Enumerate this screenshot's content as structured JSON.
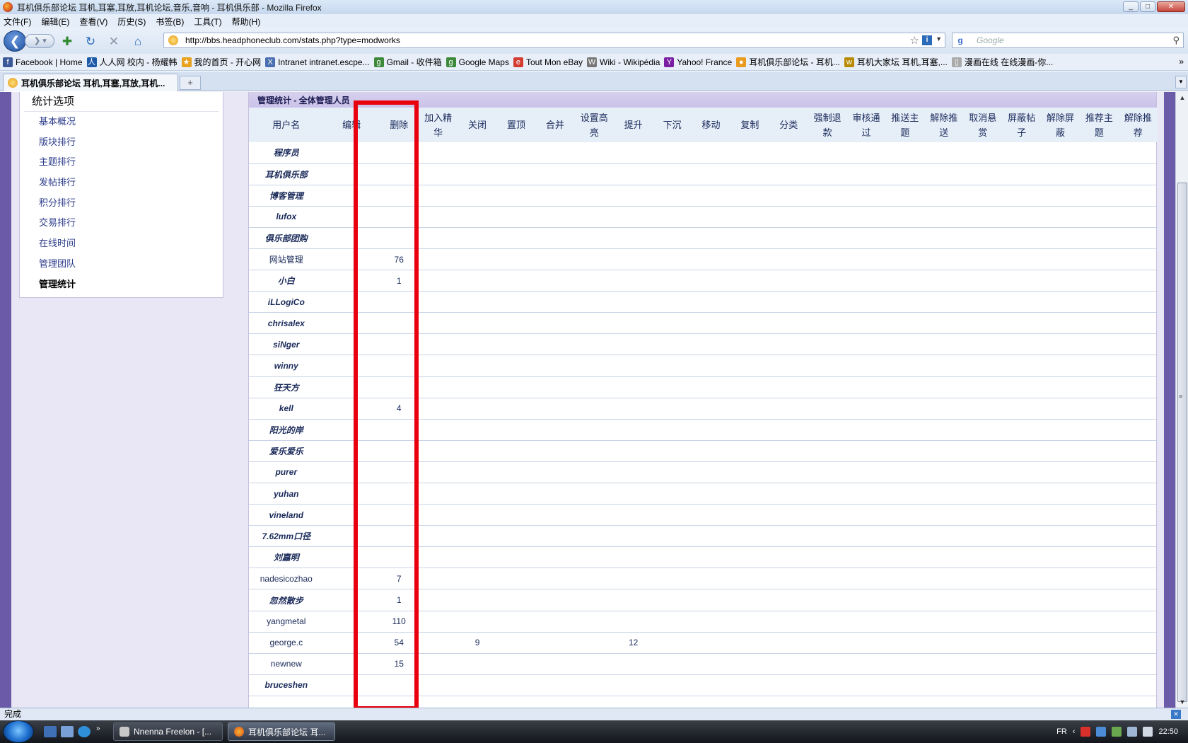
{
  "window": {
    "title": "耳机俱乐部论坛 耳机,耳塞,耳放,耳机论坛,音乐,音响 - 耳机俱乐部 - Mozilla Firefox",
    "buttons": [
      "_",
      "□",
      "✕"
    ]
  },
  "menu": [
    "文件(F)",
    "编辑(E)",
    "查看(V)",
    "历史(S)",
    "书签(B)",
    "工具(T)",
    "帮助(H)"
  ],
  "toolbar": {
    "url": "http://bbs.headphoneclub.com/stats.php?type=modworks",
    "search_placeholder": "Google"
  },
  "bookmarks": [
    {
      "label": "Facebook | Home",
      "icon": "facebook-icon",
      "color": "#3b5998",
      "glyph": "f"
    },
    {
      "label": "人人网 校内 - 杨耀韩",
      "icon": "renren-icon",
      "color": "#1e5aa8",
      "glyph": "人"
    },
    {
      "label": "我的首页 - 开心网",
      "icon": "kaixin-icon",
      "color": "#e8a21e",
      "glyph": "★"
    },
    {
      "label": "Intranet intranet.escpe...",
      "icon": "intranet-icon",
      "color": "#4a6fb0",
      "glyph": "X"
    },
    {
      "label": "Gmail - 收件箱",
      "icon": "google-icon",
      "color": "#3c8a3a",
      "glyph": "g"
    },
    {
      "label": "Google Maps",
      "icon": "google-icon",
      "color": "#3c8a3a",
      "glyph": "g"
    },
    {
      "label": "Tout Mon eBay",
      "icon": "ebay-icon",
      "color": "#d33c2f",
      "glyph": "e"
    },
    {
      "label": "Wiki - Wikipédia",
      "icon": "wikipedia-icon",
      "color": "#777777",
      "glyph": "W"
    },
    {
      "label": "Yahoo! France",
      "icon": "yahoo-icon",
      "color": "#7b1fa2",
      "glyph": "Y"
    },
    {
      "label": "耳机俱乐部论坛 - 耳机...",
      "icon": "headphoneclub-icon",
      "color": "#e89b1c",
      "glyph": "●"
    },
    {
      "label": "耳机大家坛 耳机,耳塞,...",
      "icon": "forum-icon",
      "color": "#b88a00",
      "glyph": "w"
    },
    {
      "label": "漫画在线 在线漫画-你...",
      "icon": "page-icon",
      "color": "#aaaaaa",
      "glyph": "▯"
    }
  ],
  "tab": {
    "label": "耳机俱乐部论坛 耳机,耳塞,耳放,耳机..."
  },
  "sidebar": {
    "title": "统计选项",
    "items": [
      "基本概况",
      "版块排行",
      "主题排行",
      "发帖排行",
      "积分排行",
      "交易排行",
      "在线时间",
      "管理团队",
      "管理统计"
    ],
    "active": "管理统计"
  },
  "panel": {
    "title": "管理统计 - 全体管理人员",
    "columns": [
      "用户名",
      "编辑",
      "删除",
      "加入精华",
      "关闭",
      "置顶",
      "合并",
      "设置高亮",
      "提升",
      "下沉",
      "移动",
      "复制",
      "分类",
      "强制退款",
      "审核通过",
      "推送主题",
      "解除推送",
      "取消悬赏",
      "屏蔽帖子",
      "解除屏蔽",
      "推荐主题",
      "解除推荐"
    ],
    "rows": [
      {
        "name": "程序员",
        "bold": true,
        "values": [
          "",
          "",
          "",
          "",
          "",
          "",
          "",
          "",
          "",
          "",
          "",
          "",
          "",
          "",
          "",
          "",
          "",
          "",
          "",
          "",
          ""
        ]
      },
      {
        "name": "耳机俱乐部",
        "bold": true,
        "values": [
          "",
          "",
          "",
          "",
          "",
          "",
          "",
          "",
          "",
          "",
          "",
          "",
          "",
          "",
          "",
          "",
          "",
          "",
          "",
          "",
          ""
        ]
      },
      {
        "name": "博客管理",
        "bold": true,
        "values": [
          "",
          "",
          "",
          "",
          "",
          "",
          "",
          "",
          "",
          "",
          "",
          "",
          "",
          "",
          "",
          "",
          "",
          "",
          "",
          "",
          ""
        ]
      },
      {
        "name": "lufox",
        "bold": true,
        "values": [
          "",
          "",
          "",
          "",
          "",
          "",
          "",
          "",
          "",
          "",
          "",
          "",
          "",
          "",
          "",
          "",
          "",
          "",
          "",
          "",
          ""
        ]
      },
      {
        "name": "俱乐部团购",
        "bold": true,
        "values": [
          "",
          "",
          "",
          "",
          "",
          "",
          "",
          "",
          "",
          "",
          "",
          "",
          "",
          "",
          "",
          "",
          "",
          "",
          "",
          "",
          ""
        ]
      },
      {
        "name": "网站管理",
        "bold": false,
        "values": [
          "",
          "76",
          "",
          "",
          "",
          "",
          "",
          "",
          "",
          "",
          "",
          "",
          "",
          "",
          "",
          "",
          "",
          "",
          "",
          "",
          ""
        ]
      },
      {
        "name": "小白",
        "bold": true,
        "values": [
          "",
          "1",
          "",
          "",
          "",
          "",
          "",
          "",
          "",
          "",
          "",
          "",
          "",
          "",
          "",
          "",
          "",
          "",
          "",
          "",
          ""
        ]
      },
      {
        "name": "iLLogiCo",
        "bold": true,
        "values": [
          "",
          "",
          "",
          "",
          "",
          "",
          "",
          "",
          "",
          "",
          "",
          "",
          "",
          "",
          "",
          "",
          "",
          "",
          "",
          "",
          ""
        ]
      },
      {
        "name": "chrisalex",
        "bold": true,
        "values": [
          "",
          "",
          "",
          "",
          "",
          "",
          "",
          "",
          "",
          "",
          "",
          "",
          "",
          "",
          "",
          "",
          "",
          "",
          "",
          "",
          ""
        ]
      },
      {
        "name": "siNger",
        "bold": true,
        "values": [
          "",
          "",
          "",
          "",
          "",
          "",
          "",
          "",
          "",
          "",
          "",
          "",
          "",
          "",
          "",
          "",
          "",
          "",
          "",
          "",
          ""
        ]
      },
      {
        "name": "winny",
        "bold": true,
        "values": [
          "",
          "",
          "",
          "",
          "",
          "",
          "",
          "",
          "",
          "",
          "",
          "",
          "",
          "",
          "",
          "",
          "",
          "",
          "",
          "",
          ""
        ]
      },
      {
        "name": "狂天方",
        "bold": true,
        "values": [
          "",
          "",
          "",
          "",
          "",
          "",
          "",
          "",
          "",
          "",
          "",
          "",
          "",
          "",
          "",
          "",
          "",
          "",
          "",
          "",
          ""
        ]
      },
      {
        "name": "kell",
        "bold": true,
        "values": [
          "",
          "4",
          "",
          "",
          "",
          "",
          "",
          "",
          "",
          "",
          "",
          "",
          "",
          "",
          "",
          "",
          "",
          "",
          "",
          "",
          ""
        ]
      },
      {
        "name": "阳光的岸",
        "bold": true,
        "values": [
          "",
          "",
          "",
          "",
          "",
          "",
          "",
          "",
          "",
          "",
          "",
          "",
          "",
          "",
          "",
          "",
          "",
          "",
          "",
          "",
          ""
        ]
      },
      {
        "name": "爱乐爱乐",
        "bold": true,
        "values": [
          "",
          "",
          "",
          "",
          "",
          "",
          "",
          "",
          "",
          "",
          "",
          "",
          "",
          "",
          "",
          "",
          "",
          "",
          "",
          "",
          ""
        ]
      },
      {
        "name": "purer",
        "bold": true,
        "values": [
          "",
          "",
          "",
          "",
          "",
          "",
          "",
          "",
          "",
          "",
          "",
          "",
          "",
          "",
          "",
          "",
          "",
          "",
          "",
          "",
          ""
        ]
      },
      {
        "name": "yuhan",
        "bold": true,
        "values": [
          "",
          "",
          "",
          "",
          "",
          "",
          "",
          "",
          "",
          "",
          "",
          "",
          "",
          "",
          "",
          "",
          "",
          "",
          "",
          "",
          ""
        ]
      },
      {
        "name": "vineland",
        "bold": true,
        "values": [
          "",
          "",
          "",
          "",
          "",
          "",
          "",
          "",
          "",
          "",
          "",
          "",
          "",
          "",
          "",
          "",
          "",
          "",
          "",
          "",
          ""
        ]
      },
      {
        "name": "7.62mm口径",
        "bold": true,
        "values": [
          "",
          "",
          "",
          "",
          "",
          "",
          "",
          "",
          "",
          "",
          "",
          "",
          "",
          "",
          "",
          "",
          "",
          "",
          "",
          "",
          ""
        ]
      },
      {
        "name": "刘嘉明",
        "bold": true,
        "values": [
          "",
          "",
          "",
          "",
          "",
          "",
          "",
          "",
          "",
          "",
          "",
          "",
          "",
          "",
          "",
          "",
          "",
          "",
          "",
          "",
          ""
        ]
      },
      {
        "name": "nadesicozhao",
        "bold": false,
        "values": [
          "",
          "7",
          "",
          "",
          "",
          "",
          "",
          "",
          "",
          "",
          "",
          "",
          "",
          "",
          "",
          "",
          "",
          "",
          "",
          "",
          ""
        ]
      },
      {
        "name": "忽然散步",
        "bold": true,
        "values": [
          "",
          "1",
          "",
          "",
          "",
          "",
          "",
          "",
          "",
          "",
          "",
          "",
          "",
          "",
          "",
          "",
          "",
          "",
          "",
          "",
          ""
        ]
      },
      {
        "name": "yangmetal",
        "bold": false,
        "values": [
          "",
          "110",
          "",
          "",
          "",
          "",
          "",
          "",
          "",
          "",
          "",
          "",
          "",
          "",
          "",
          "",
          "",
          "",
          "",
          "",
          ""
        ]
      },
      {
        "name": "george.c",
        "bold": false,
        "values": [
          "",
          "54",
          "",
          "9",
          "",
          "",
          "",
          "12",
          "",
          "",
          "",
          "",
          "",
          "",
          "",
          "",
          "",
          "",
          "",
          "",
          ""
        ]
      },
      {
        "name": "newnew",
        "bold": false,
        "values": [
          "",
          "15",
          "",
          "",
          "",
          "",
          "",
          "",
          "",
          "",
          "",
          "",
          "",
          "",
          "",
          "",
          "",
          "",
          "",
          "",
          ""
        ]
      },
      {
        "name": "bruceshen",
        "bold": true,
        "values": [
          "",
          "",
          "",
          "",
          "",
          "",
          "",
          "",
          "",
          "",
          "",
          "",
          "",
          "",
          "",
          "",
          "",
          "",
          "",
          "",
          ""
        ]
      }
    ]
  },
  "status": {
    "text": "完成"
  },
  "taskbar": {
    "tasks": [
      {
        "label": "Nnenna Freelon - [...",
        "active": false
      },
      {
        "label": "耳机俱乐部论坛 耳...",
        "active": true
      }
    ],
    "language": "FR",
    "clock": "22:50"
  },
  "colors": {
    "highlight": "#e8000e",
    "page_bg": "#6a5aa8",
    "header_bg": "#e6eef8"
  }
}
